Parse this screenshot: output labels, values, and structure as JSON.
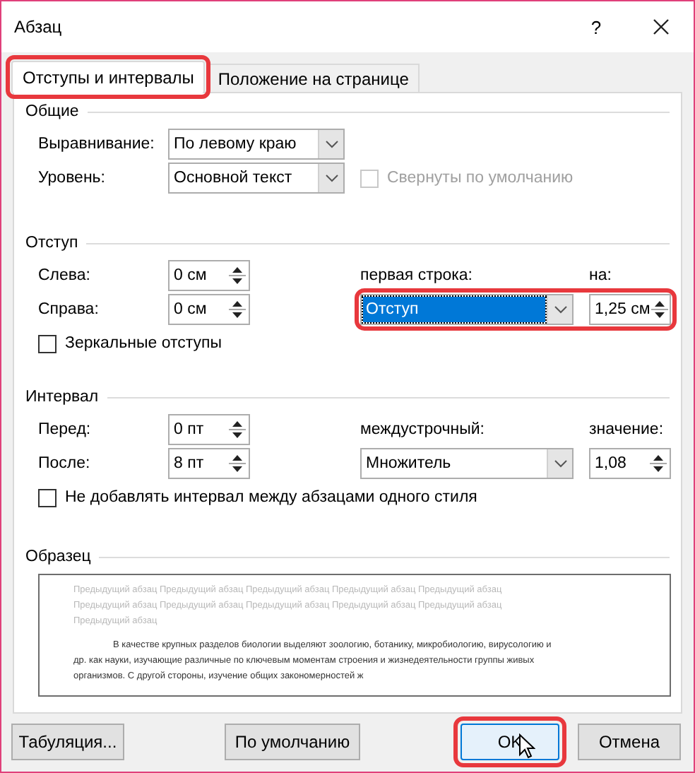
{
  "window": {
    "title": "Абзац",
    "help": "?"
  },
  "tabs": [
    {
      "label": "Отступы и интервалы",
      "selected": true,
      "highlighted": true
    },
    {
      "label": "Положение на странице",
      "selected": false,
      "highlighted": false
    }
  ],
  "general": {
    "title": "Общие",
    "alignment": {
      "label": "Выравнивание:",
      "value": "По левому краю"
    },
    "level": {
      "label": "Уровень:",
      "value": "Основной текст"
    },
    "collapsed": {
      "label": "Свернуты по умолчанию",
      "checked": false,
      "disabled": true
    }
  },
  "indent": {
    "title": "Отступ",
    "left": {
      "label": "Слева:",
      "value": "0 см"
    },
    "right": {
      "label": "Справа:",
      "value": "0 см"
    },
    "first_line": {
      "label": "первая строка:",
      "value": "Отступ",
      "focused": true
    },
    "by": {
      "label": "на:",
      "value": "1,25 см"
    },
    "highlighted": true,
    "mirror": {
      "label": "Зеркальные отступы",
      "checked": false,
      "disabled": false
    }
  },
  "spacing": {
    "title": "Интервал",
    "before": {
      "label": "Перед:",
      "value": "0 пт"
    },
    "after": {
      "label": "После:",
      "value": "8 пт"
    },
    "line_spacing": {
      "label": "междустрочный:",
      "value": "Множитель",
      "focused": false
    },
    "at": {
      "label": "значение:",
      "value": "1,08"
    },
    "dont_add": {
      "label": "Не добавлять интервал между абзацами одного стиля",
      "checked": false,
      "disabled": false
    }
  },
  "preview": {
    "title": "Образец",
    "previous": "Предыдущий абзац Предыдущий абзац Предыдущий абзац Предыдущий абзац Предыдущий абзац Предыдущий абзац Предыдущий абзац Предыдущий абзац Предыдущий абзац Предыдущий абзац Предыдущий абзац",
    "sample": "В качестве крупных разделов биологии выделяют зоологию, ботанику, микробиологию, вирусологию и др. как науки, изучающие различные по ключевым моментам строения и жизнедеятельности группы живых организмов. С другой стороны, изучение общих закономерностей ж"
  },
  "buttons": [
    {
      "label": "Табуляция...",
      "hovered": false,
      "highlighted": false
    },
    {
      "label": "По умолчанию",
      "hovered": false,
      "highlighted": false
    },
    {
      "label": "OK",
      "hovered": true,
      "highlighted": true
    },
    {
      "label": "Отмена",
      "hovered": false,
      "highlighted": false
    }
  ]
}
